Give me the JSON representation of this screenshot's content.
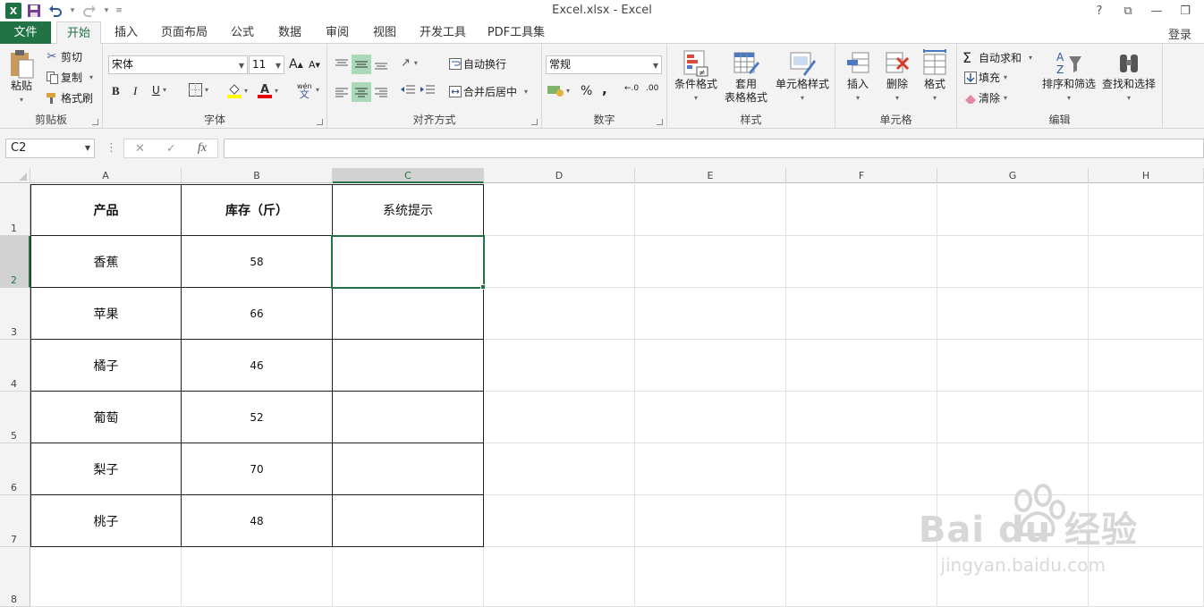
{
  "window": {
    "title": "Excel.xlsx - Excel",
    "help": "?",
    "controls": [
      "?",
      "⧉",
      "—",
      "❐"
    ]
  },
  "tabs": {
    "file": "文件",
    "items": [
      "开始",
      "插入",
      "页面布局",
      "公式",
      "数据",
      "审阅",
      "视图",
      "开发工具",
      "PDF工具集"
    ],
    "active": "开始",
    "login": "登录"
  },
  "ribbon": {
    "clipboard": {
      "label": "剪贴板",
      "paste": "粘贴",
      "cut": "剪切",
      "copy": "复制",
      "format_painter": "格式刷"
    },
    "font": {
      "label": "字体",
      "font_name": "宋体",
      "font_size": "11",
      "bold": "B",
      "italic": "I",
      "underline": "U",
      "grow": "A",
      "shrink": "A",
      "phonetic": "wén"
    },
    "alignment": {
      "label": "对齐方式",
      "wrap": "自动换行",
      "merge": "合并后居中"
    },
    "number": {
      "label": "数字",
      "format": "常规",
      "percent": "%",
      "comma": ",",
      "inc_dec": "←.0",
      "dec_dec": ".00"
    },
    "styles": {
      "label": "样式",
      "conditional": "条件格式",
      "table_line1": "套用",
      "table_line2": "表格格式",
      "cell_styles": "单元格样式"
    },
    "cells": {
      "label": "单元格",
      "insert": "插入",
      "delete": "删除",
      "format": "格式"
    },
    "editing": {
      "label": "编辑",
      "autosum": "自动求和",
      "fill": "填充",
      "clear": "清除",
      "sort": "排序和筛选",
      "find": "查找和选择"
    }
  },
  "formula_bar": {
    "name_box": "C2",
    "cancel": "✕",
    "enter": "✓",
    "fx": "fx",
    "value": ""
  },
  "columns": [
    "A",
    "B",
    "C",
    "D",
    "E",
    "F",
    "G",
    "H"
  ],
  "rows": [
    "1",
    "2",
    "3",
    "4",
    "5",
    "6",
    "7",
    "8"
  ],
  "table": {
    "headers": [
      "产品",
      "库存（斤）",
      "系统提示"
    ],
    "rows": [
      [
        "香蕉",
        "58",
        ""
      ],
      [
        "苹果",
        "66",
        ""
      ],
      [
        "橘子",
        "46",
        ""
      ],
      [
        "葡萄",
        "52",
        ""
      ],
      [
        "梨子",
        "70",
        ""
      ],
      [
        "桃子",
        "48",
        ""
      ]
    ]
  },
  "selection": {
    "cell": "C2",
    "column": "C",
    "row": "2"
  },
  "watermark": {
    "brand": "Bai du 经验",
    "url": "jingyan.baidu.com"
  },
  "colors": {
    "accent": "#217346",
    "ribbon_bg": "#f3f3f3",
    "highlight": "#a9d9b8"
  }
}
